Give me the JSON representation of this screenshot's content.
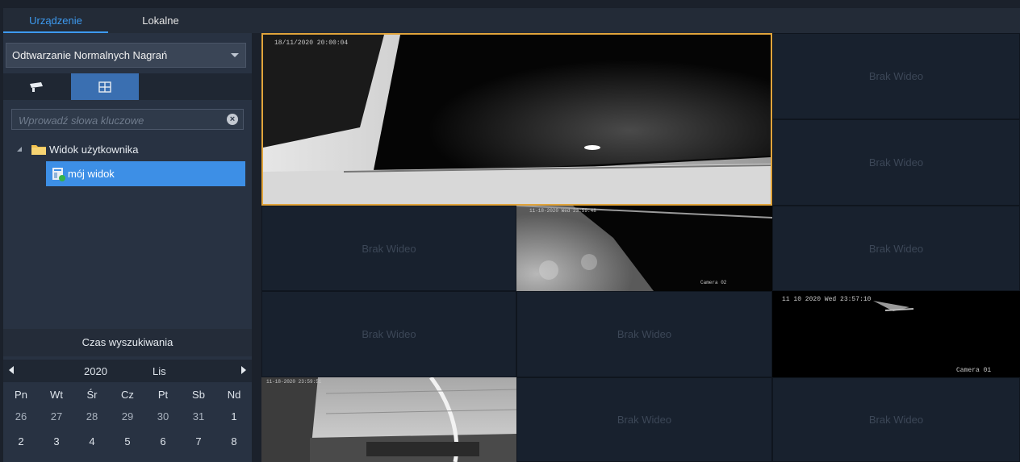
{
  "tabs": [
    "Urządzenie",
    "Lokalne"
  ],
  "playback_mode": "Odtwarzanie Normalnych Nagrań",
  "search": {
    "placeholder": "Wprowadź słowa kluczowe"
  },
  "tree": {
    "root": "Widok użytkownika",
    "child": "mój widok"
  },
  "search_time_title": "Czas wyszukiwania",
  "calendar": {
    "year": "2020",
    "month": "Lis",
    "weekdays": [
      "Pn",
      "Wt",
      "Śr",
      "Cz",
      "Pt",
      "Sb",
      "Nd"
    ],
    "rows": [
      [
        "26",
        "27",
        "28",
        "29",
        "30",
        "31",
        "1"
      ],
      [
        "2",
        "3",
        "4",
        "5",
        "6",
        "7",
        "8"
      ]
    ]
  },
  "no_video": "Brak Wideo",
  "cameras": {
    "main_osd": "18/11/2020 20:00:04",
    "cam3_osd": "11 10 2020 Wed 23:57:10",
    "cam3_name": "Camera 01",
    "cam2_osd": "11-18-2020 Wed 23:59:48",
    "cam2_name": "Camera 02",
    "cam4_osd": "11-18-2020 23:59:51"
  },
  "colors": {
    "accent": "#3d9af0",
    "selection": "#3d8fe6",
    "selected_window": "#e1a43b"
  }
}
